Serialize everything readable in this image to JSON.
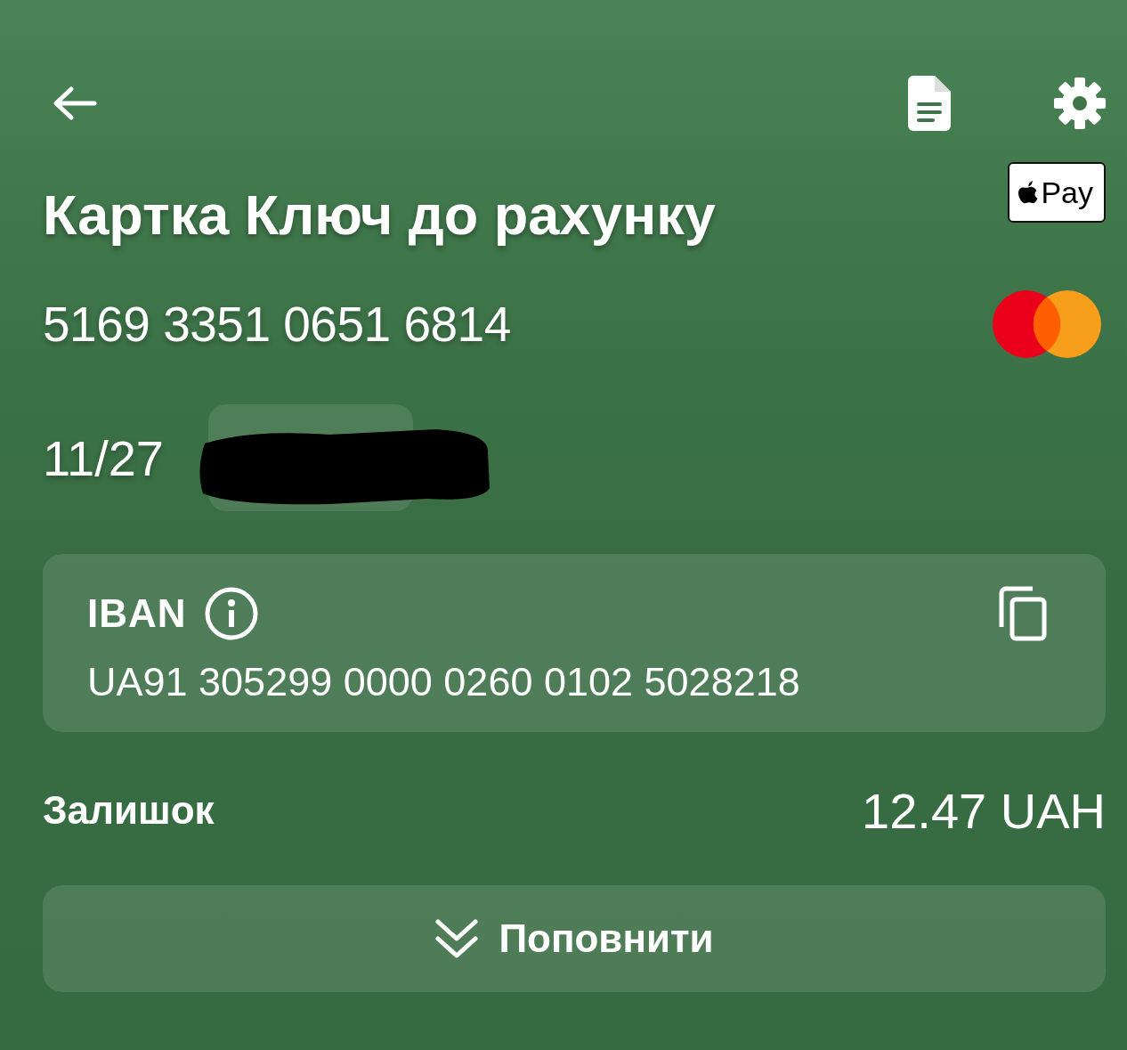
{
  "title": "Картка Ключ до рахунку",
  "wallet_badge": {
    "label": "Pay"
  },
  "card_number": "5169 3351 0651 6814",
  "expiry": "11/27",
  "iban": {
    "label": "IBAN",
    "value": "UA91 305299 0000 0260 0102 5028218"
  },
  "balance": {
    "label": "Залишок",
    "amount": "12.47 UAH"
  },
  "top_up_button": {
    "label": "Поповнити"
  }
}
